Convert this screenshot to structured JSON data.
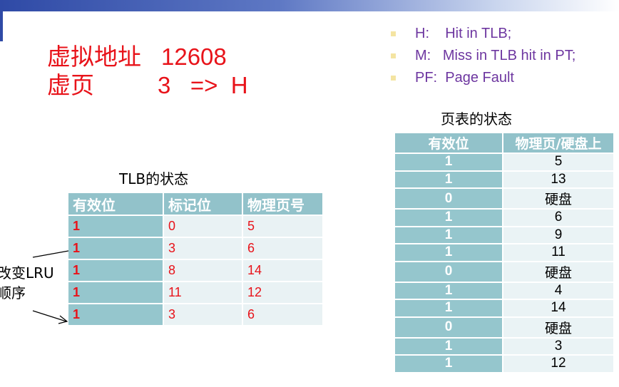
{
  "main": {
    "vaddr_label": "虚拟地址",
    "vaddr_value": "12608",
    "vpage_label": "虚页",
    "vpage_value": "3   =>  H"
  },
  "legend": [
    {
      "text": "H:    Hit in TLB;"
    },
    {
      "text": "M:   Miss in TLB hit in PT;"
    },
    {
      "text": "PF:  Page Fault"
    }
  ],
  "tlb": {
    "title": "TLB的状态",
    "headers": [
      "有效位",
      "标记位",
      "物理页号"
    ],
    "rows": [
      [
        "1",
        "0",
        "5"
      ],
      [
        "1",
        "3",
        "6"
      ],
      [
        "1",
        "8",
        "14"
      ],
      [
        "1",
        "11",
        "12"
      ],
      [
        "1",
        "3",
        "6"
      ]
    ]
  },
  "page_table": {
    "title": "页表的状态",
    "headers": [
      "有效位",
      "物理页/硬盘上"
    ],
    "rows": [
      [
        "1",
        "5"
      ],
      [
        "1",
        "13"
      ],
      [
        "0",
        "硬盘"
      ],
      [
        "1",
        "6"
      ],
      [
        "1",
        "9"
      ],
      [
        "1",
        "11"
      ],
      [
        "0",
        "硬盘"
      ],
      [
        "1",
        "4"
      ],
      [
        "1",
        "14"
      ],
      [
        "0",
        "硬盘"
      ],
      [
        "1",
        "3"
      ],
      [
        "1",
        "12"
      ]
    ]
  },
  "annotation": {
    "line1": "改变LRU",
    "line2": "顺序"
  },
  "colors": {
    "red": "#e8131a",
    "purple": "#6d36a0",
    "teal_header": "#92c2ca",
    "light_cell": "#e9f2f4"
  }
}
